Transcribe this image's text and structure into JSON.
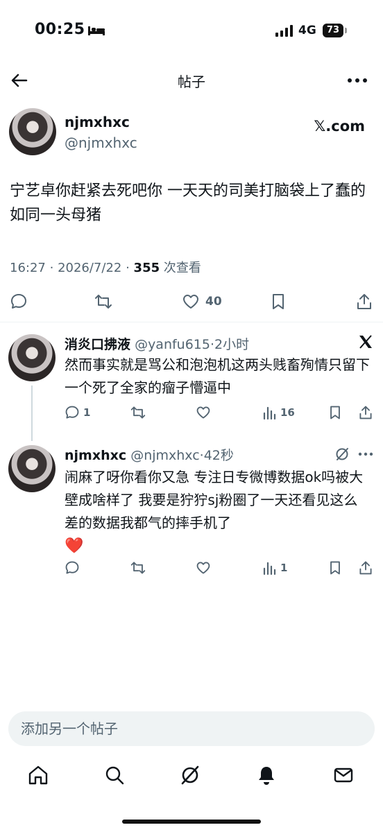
{
  "status_bar": {
    "time": "00:25",
    "network": "4G",
    "battery": "73"
  },
  "nav": {
    "title": "帖子"
  },
  "post": {
    "name": "njmxhxc",
    "handle": "@njmxhxc",
    "source": "𝕏.com",
    "text": "宁艺卓你赶紧去死吧你 一天天的司美打脑袋上了蠢的如同一头母猪",
    "time": "16:27",
    "date": "2026/7/22",
    "views": "355",
    "views_label": "次查看",
    "likes": "40"
  },
  "replies": [
    {
      "name": "消炎口拂液",
      "handle": "@yanfu615",
      "time": "2小时",
      "text": "然而事实就是骂公和泡泡机这两头贱畜殉情只留下一个死了全家的瘤子懵逼中",
      "replies_count": "1",
      "views": "16"
    },
    {
      "name": "njmxhxc",
      "handle": "@njmxhxc",
      "time": "42秒",
      "text": "闹麻了呀你看你又急 专注日专微博数据ok吗被大壁成啥样了 我要是狞狞sj粉圈了一天还看见这么差的数据我都气的摔手机了",
      "emoji": "❤️",
      "views": "1"
    }
  ],
  "compose": {
    "placeholder": "添加另一个帖子"
  },
  "colors": {
    "text": "#0f1419",
    "secondary": "#536471",
    "divider": "#eff3f4",
    "heart": "#e0245e"
  },
  "icons": [
    "back-arrow-icon",
    "more-icon",
    "reply-icon",
    "repost-icon",
    "like-icon",
    "bookmark-icon",
    "share-icon",
    "views-icon",
    "x-logo-icon",
    "grok-icon",
    "home-icon",
    "search-icon",
    "notifications-icon",
    "messages-icon"
  ]
}
